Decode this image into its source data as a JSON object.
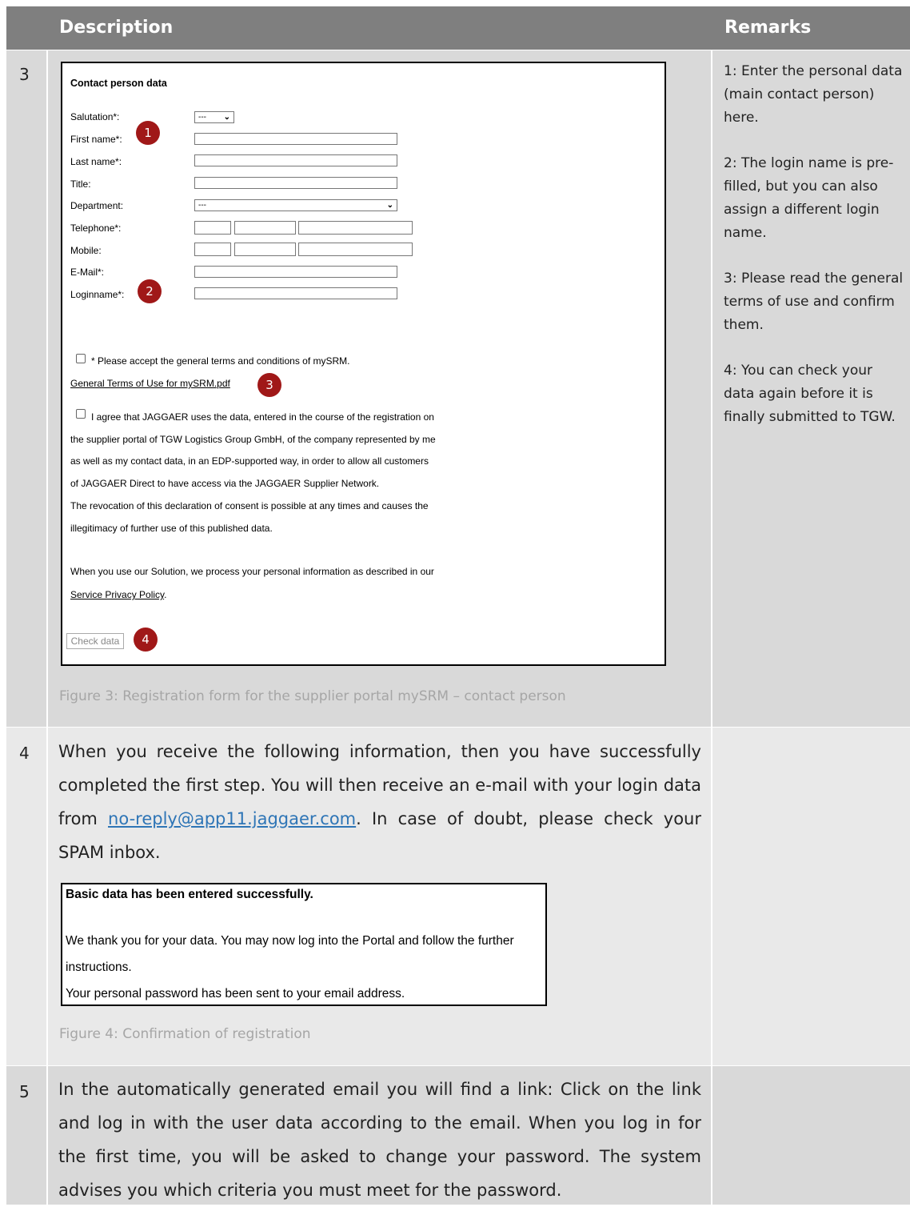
{
  "header": {
    "description": "Description",
    "remarks": "Remarks"
  },
  "rows": [
    {
      "number": "3",
      "form": {
        "title": "Contact person data",
        "fields": {
          "salutation": {
            "label": "Salutation*:",
            "value": "---"
          },
          "first_name": {
            "label": "First name*:"
          },
          "last_name": {
            "label": "Last name*:"
          },
          "title": {
            "label": "Title:"
          },
          "department": {
            "label": "Department:",
            "value": "---"
          },
          "telephone": {
            "label": "Telephone*:"
          },
          "mobile": {
            "label": "Mobile:"
          },
          "email": {
            "label": "E-Mail*:"
          },
          "loginname": {
            "label": "Loginname*:"
          }
        },
        "terms_checkbox": "* Please accept the general terms and conditions of mySRM.",
        "terms_link": "General Terms of Use for mySRM.pdf",
        "consent_lines": [
          "I agree that JAGGAER uses the data, entered in the course of the registration on",
          "the supplier portal of TGW Logistics Group GmbH, of the company represented by me",
          "as well as my contact data, in an EDP-supported way, in order to allow all customers",
          "of JAGGAER Direct to have access via the JAGGAER Supplier Network.",
          "The revocation of this declaration of consent is possible at any times and causes the",
          "illegitimacy of further use of this published data."
        ],
        "privacy_line": "When you use our Solution, we process your personal information as described in our",
        "privacy_link": "Service Privacy Policy",
        "privacy_suffix": ".",
        "check_button": "Check data",
        "badges": [
          "1",
          "2",
          "3",
          "4"
        ]
      },
      "caption": "Figure 3: Registration form for the supplier portal mySRM – contact person",
      "remarks": [
        "1: Enter the personal data (main contact person) here.",
        "2: The login name is pre-filled, but you can also assign a different login name.",
        "3: Please read the general terms of use and confirm them.",
        "4: You can check your data again before it is finally submitted to TGW."
      ]
    },
    {
      "number": "4",
      "text_before": "When you receive the following information, then you have successfully completed the first step. You will then receive an e-mail with your login data from ",
      "email_link": "no-reply@app11.jaggaer.com",
      "text_after": ". In case of doubt, please check your SPAM inbox.",
      "confirmation": {
        "title": "Basic data has been entered successfully.",
        "line1": "We thank you for your data. You may now log into the Portal and follow the further",
        "line2": "instructions.",
        "line3": "Your personal password has been sent to your email address."
      },
      "caption": "Figure 4: Confirmation of registration"
    },
    {
      "number": "5",
      "text": "In the automatically generated email you will find a link: Click on the link and log in with the user data according to the email. When you log in for the first time, you will be asked to change your password. The system advises you which criteria you must meet for the password."
    }
  ]
}
